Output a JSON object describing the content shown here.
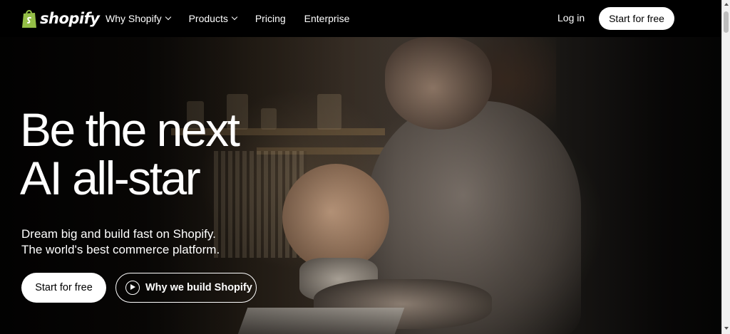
{
  "nav": {
    "logo_text": "shopify",
    "links": [
      {
        "label": "Why Shopify",
        "has_dropdown": true
      },
      {
        "label": "Products",
        "has_dropdown": true
      },
      {
        "label": "Pricing",
        "has_dropdown": false
      },
      {
        "label": "Enterprise",
        "has_dropdown": false
      }
    ],
    "login_label": "Log in",
    "start_label": "Start for free"
  },
  "hero": {
    "headline_line1": "Be the next",
    "headline_line2": "AI all-star",
    "sub_line1": "Dream big and build fast on Shopify.",
    "sub_line2": "The world's best commerce platform.",
    "primary_cta": "Start for free",
    "secondary_cta": "Why we build Shopify"
  },
  "colors": {
    "brand_green": "#95bf47",
    "nav_bg": "#000000",
    "button_bg": "#ffffff"
  }
}
